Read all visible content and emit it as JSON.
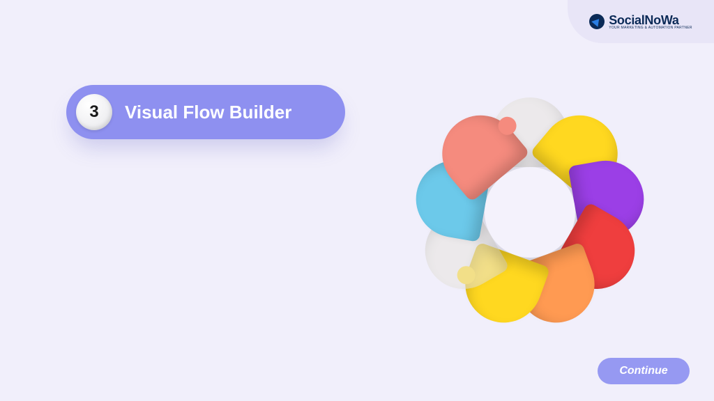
{
  "brand": {
    "name": "SocialNoWa",
    "tagline": "YOUR MARKETING & AUTOMATION PARTNER"
  },
  "title": {
    "number": "3",
    "text": "Visual Flow Builder"
  },
  "continue": {
    "label": "Continue"
  },
  "puzzle": {
    "segments": [
      {
        "name": "segment-clear-top",
        "color": "#e8e5de",
        "opacity": 0.55
      },
      {
        "name": "segment-yellow-tr",
        "color": "#ffd820",
        "opacity": 1
      },
      {
        "name": "segment-purple",
        "color": "#9b3fe6",
        "opacity": 1
      },
      {
        "name": "segment-red",
        "color": "#ef3e3e",
        "opacity": 1
      },
      {
        "name": "segment-orange",
        "color": "#ff9a52",
        "opacity": 1
      },
      {
        "name": "segment-yellow-bl",
        "color": "#ffd820",
        "opacity": 1
      },
      {
        "name": "segment-clear-left",
        "color": "#e8e5de",
        "opacity": 0.55
      },
      {
        "name": "segment-blue",
        "color": "#6cc9ea",
        "opacity": 1
      },
      {
        "name": "segment-coral",
        "color": "#f58b7e",
        "opacity": 1
      }
    ]
  },
  "colors": {
    "accent": "#8e90f0",
    "background": "#f1effb"
  }
}
